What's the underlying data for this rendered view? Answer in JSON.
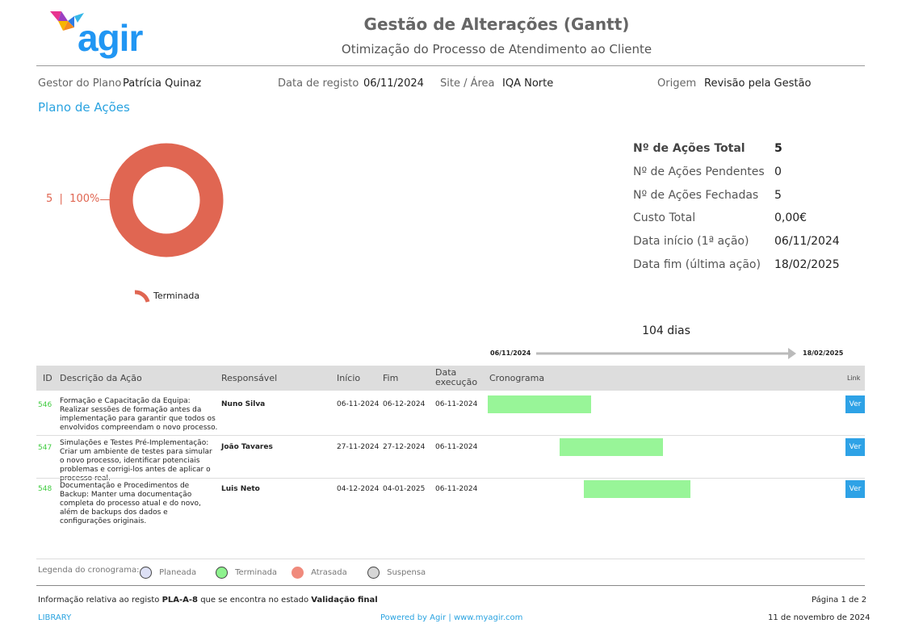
{
  "brand": {
    "name": "agir"
  },
  "header": {
    "title": "Gestão de Alterações (Gantt)",
    "subtitle": "Otimização do Processo de Atendimento ao Cliente"
  },
  "info": {
    "manager_label": "Gestor do Plano",
    "manager_value": "Patrícia Quinaz",
    "date_label": "Data de registo",
    "date_value": "06/11/2024",
    "site_label": "Site / Área",
    "site_value": "IQA Norte",
    "origin_label": "Origem",
    "origin_value": "Revisão pela Gestão"
  },
  "section_title": "Plano de Ações",
  "donut": {
    "label": "5  |  100%",
    "legend": "Terminada",
    "color": "#e06652",
    "slices": [
      {
        "name": "Terminada",
        "count": 5,
        "percent": 100
      }
    ]
  },
  "stats": [
    {
      "label": "Nº de Ações Total",
      "value": "5"
    },
    {
      "label": "Nº de Ações Pendentes",
      "value": "0"
    },
    {
      "label": "Nº de Ações Fechadas",
      "value": "5"
    },
    {
      "label": "Custo Total",
      "value": "0,00€"
    },
    {
      "label": "Data início (1ª ação)",
      "value": "06/11/2024"
    },
    {
      "label": "Data fim (última ação)",
      "value": "18/02/2025"
    }
  ],
  "timeline": {
    "duration": "104 dias",
    "start": "06/11/2024",
    "end": "18/02/2025"
  },
  "table": {
    "headers": {
      "id": "ID",
      "desc": "Descrição da Ação",
      "resp": "Responsável",
      "start": "Início",
      "end": "Fim",
      "exec": "Data execução",
      "gantt": "Cronograma",
      "link": "Link"
    },
    "rows": [
      {
        "id": "546",
        "desc": "Formação e Capacitação da Equipa: Realizar sessões de formação antes da implementação para garantir que todos os envolvidos compreendam o novo processo.",
        "resp": "Nuno Silva",
        "start": "06-11-2024",
        "end": "06-12-2024",
        "exec": "06-11-2024",
        "link": "Ver"
      },
      {
        "id": "547",
        "desc": "Simulações e Testes Pré-Implementação: Criar um ambiente de testes para simular o novo processo, identificar potenciais problemas e corrigi-los antes de aplicar o processo real.",
        "resp": "João Tavares",
        "start": "27-11-2024",
        "end": "27-12-2024",
        "exec": "06-11-2024",
        "link": "Ver"
      },
      {
        "id": "548",
        "desc": "Documentação e Procedimentos de Backup: Manter uma documentação completa do processo atual e do novo, além de backups dos dados e configurações originais.",
        "resp": "Luis Neto",
        "start": "04-12-2024",
        "end": "04-01-2025",
        "exec": "06-11-2024",
        "link": "Ver"
      }
    ]
  },
  "legend": {
    "title": "Legenda do cronograma:",
    "items": [
      {
        "label": "Planeada",
        "color": "#dde0f5"
      },
      {
        "label": "Terminada",
        "color": "#8ef28e"
      },
      {
        "label": "Atrasada",
        "color": "#f08a7c"
      },
      {
        "label": "Suspensa",
        "color": "#d6d6d6"
      }
    ]
  },
  "footer": {
    "info_prefix": "Informação relativa ao registo",
    "info_code": "PLA-A-8",
    "info_middle": "que se encontra no estado",
    "info_state": "Validação final",
    "page": "Página 1 de 2",
    "library": "LIBRARY",
    "powered": "Powered by Agir | www.myagir.com",
    "date": "11 de novembro de 2024"
  }
}
